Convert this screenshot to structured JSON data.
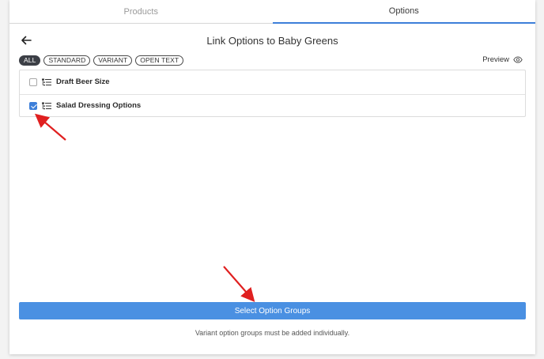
{
  "tabs": [
    {
      "label": "Products",
      "active": false
    },
    {
      "label": "Options",
      "active": true
    }
  ],
  "header": {
    "title": "Link Options to Baby Greens"
  },
  "filters": [
    {
      "label": "ALL",
      "active": true
    },
    {
      "label": "STANDARD",
      "active": false
    },
    {
      "label": "VARIANT",
      "active": false
    },
    {
      "label": "OPEN TEXT",
      "active": false
    }
  ],
  "preview": {
    "label": "Preview",
    "icon": "eye-icon"
  },
  "option_groups": [
    {
      "label": "Draft Beer Size",
      "checked": false,
      "icon": "list-icon"
    },
    {
      "label": "Salad Dressing Options",
      "checked": true,
      "icon": "list-icon"
    }
  ],
  "actions": {
    "select_label": "Select Option Groups"
  },
  "footer": {
    "note": "Variant option groups must be added individually."
  },
  "colors": {
    "accent": "#4a90e2",
    "checked": "#3d7fd9",
    "annotation_arrow": "#e02020"
  }
}
